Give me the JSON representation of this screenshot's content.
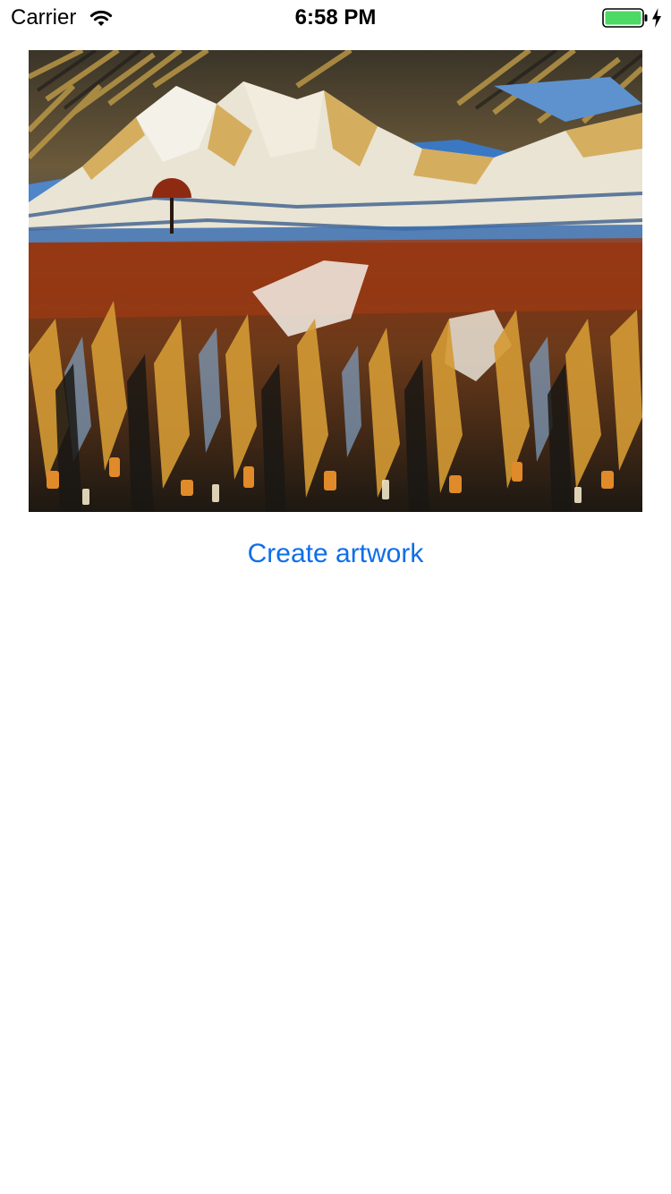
{
  "status_bar": {
    "carrier": "Carrier",
    "time": "6:58 PM",
    "battery_color": "#4cd964",
    "icons": [
      "wifi-icon",
      "battery-icon",
      "charging-bolt-icon"
    ]
  },
  "main": {
    "create_button_label": "Create artwork",
    "accent_color": "#0e6ee8"
  }
}
